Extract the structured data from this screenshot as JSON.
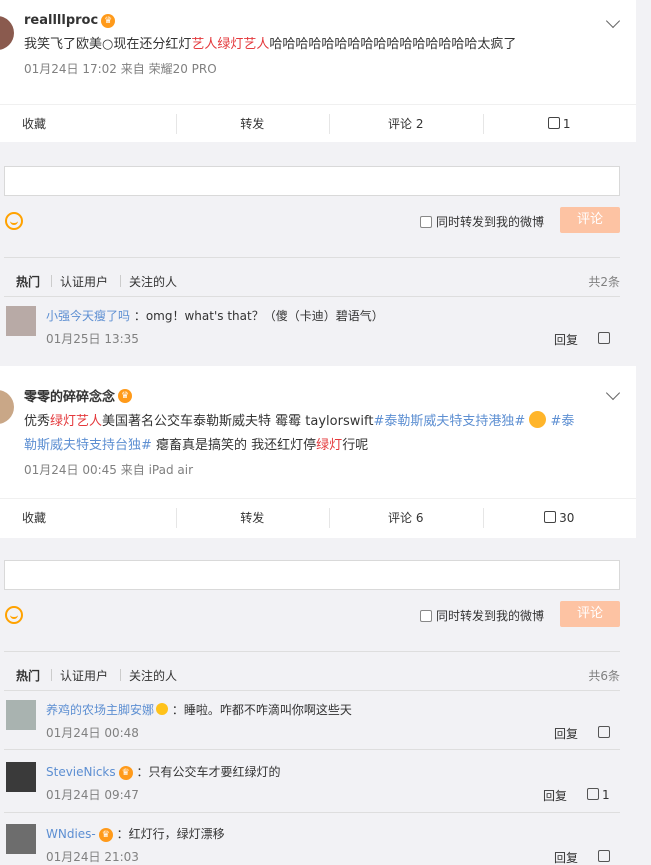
{
  "post1": {
    "user": "reallllproc",
    "crown": "♛",
    "text_a": "我笑飞了欧美○现在还分红灯",
    "text_red": "艺人绿灯艺人",
    "text_b": "哈哈哈哈哈哈哈哈哈哈哈哈哈哈哈哈太疯了",
    "meta": "01月24日 17:02  来自 荣耀20 PRO",
    "actions": {
      "fav": "收藏",
      "repost": "转发",
      "comment": "评论 2",
      "like": "1"
    },
    "input_placeholder": "",
    "sync_label": "同时转发到我的微博",
    "send": "评论",
    "filters": {
      "hot": "热门",
      "verified": "认证用户",
      "following": "关注的人",
      "total": "共2条"
    },
    "comments": [
      {
        "name": "小强今天瘦了吗",
        "text": "：omg！what's that？（傻（卡迪）碧语气）",
        "time": "01月25日 13:35",
        "reply": "回复",
        "likes": ""
      }
    ]
  },
  "post2": {
    "user": "零零的碎碎念念",
    "crown": "♛",
    "line1_a": "优秀",
    "line1_red": "绿灯艺人",
    "line1_b": "美国著名公交车泰勒斯威夫特 霉霉 taylorswift",
    "line1_tag1": "#泰勒斯威夫特支持港独#",
    "line1_tag2": "#泰",
    "line2_tag": "勒斯威夫特支持台独#",
    "line2_a": " 瘪畜真是搞笑的 我还红灯停",
    "line2_red": "绿灯",
    "line2_b": "行呢",
    "meta": "01月24日 00:45  来自 iPad air",
    "actions": {
      "fav": "收藏",
      "repost": "转发",
      "comment": "评论 6",
      "like": "30"
    },
    "sync_label": "同时转发到我的微博",
    "send": "评论",
    "filters": {
      "hot": "热门",
      "verified": "认证用户",
      "following": "关注的人",
      "total": "共6条"
    },
    "comments": [
      {
        "name": "养鸡的农场主脚安娜",
        "text": "：睡啦。咋都不咋滴叫你啊这些天",
        "time": "01月24日 00:48",
        "reply": "回复",
        "likes": ""
      },
      {
        "name": "StevieNicks",
        "text": "：只有公交车才要红绿灯的",
        "time": "01月24日 09:47",
        "reply": "回复",
        "likes": "1"
      },
      {
        "name": "WNdies-",
        "text": "：红灯行，绿灯漂移",
        "time": "01月24日 21:03",
        "reply": "回复",
        "likes": ""
      }
    ]
  },
  "colors": {
    "accent": "#eb7350",
    "link": "#5d8fd2",
    "red_text": "#e4393c",
    "send_disabled": "#fdc3a3"
  }
}
